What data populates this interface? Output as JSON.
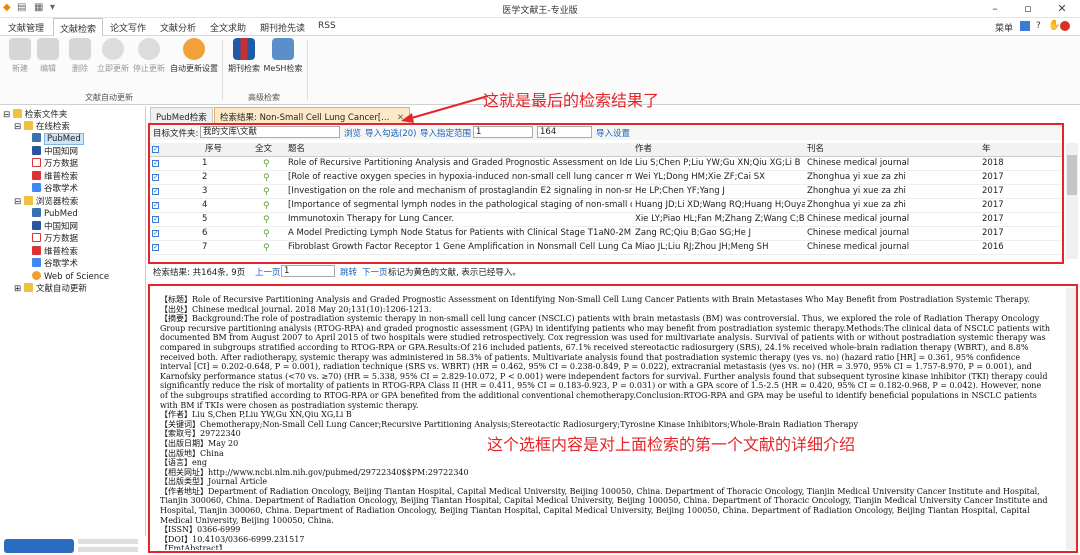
{
  "window": {
    "title": "医学文献王-专业版"
  },
  "menu": {
    "items": [
      "文献管理",
      "文献检索",
      "论文写作",
      "文献分析",
      "全文求助",
      "期刊抢先读",
      "RSS"
    ],
    "active": 1,
    "right": "菜单"
  },
  "ribbon": {
    "buttons": [
      {
        "label": "新建",
        "enabled": false
      },
      {
        "label": "编辑",
        "enabled": false
      },
      {
        "label": "删除",
        "enabled": false
      },
      {
        "label": "立即更新",
        "enabled": false
      },
      {
        "label": "停止更新",
        "enabled": false
      },
      {
        "label": "自动更新设置",
        "enabled": true
      },
      {
        "label": "期刊检索",
        "enabled": true
      },
      {
        "label": "MeSH检索",
        "enabled": true
      }
    ],
    "groups": [
      "文献自动更新",
      "高级检索"
    ]
  },
  "tree": {
    "root": "检索文件夹",
    "online": "在线检索",
    "online_items": [
      "PubMed",
      "中国知网",
      "万方数据",
      "维普检索",
      "谷歌学术"
    ],
    "browser": "浏览器检索",
    "browser_items": [
      "PubMed",
      "中国知网",
      "万方数据",
      "维普检索",
      "谷歌学术",
      "Web of Science"
    ],
    "auto": "文献自动更新"
  },
  "tabs": [
    "PubMed检索",
    "检索结果: Non-Small Cell Lung Cancer[..."
  ],
  "search_bar": {
    "target_label": "目标文件夹:",
    "target_value": "我的文库\\文献",
    "browse": "浏览",
    "import_checked": "导入勾选(20)",
    "import_range": "导入指定范围",
    "range_from": "1",
    "range_sep": "-",
    "range_to": "164",
    "import_settings": "导入设置"
  },
  "table": {
    "columns": [
      "序号",
      "全文",
      "题名",
      "作者",
      "刊名",
      "年"
    ],
    "rows": [
      {
        "no": "1",
        "title": "Role of Recursive Partitioning Analysis and Graded Prognostic Assessment on Iden...",
        "authors": "Liu S;Chen P;Liu YW;Gu XN;Qiu XG;Li B",
        "journal": "Chinese medical journal",
        "year": "2018"
      },
      {
        "no": "2",
        "title": "[Role of reactive oxygen species in hypoxia-induced non-small cell lung cancer mi...",
        "authors": "Wei YL;Dong HM;Xie ZF;Cai SX",
        "journal": "Zhonghua yi xue za zhi",
        "year": "2017"
      },
      {
        "no": "3",
        "title": "[Investigation on the role and mechanism of prostaglandin E2 signaling in non-sm...",
        "authors": "He LP;Chen YF;Yang J",
        "journal": "Zhonghua yi xue za zhi",
        "year": "2017"
      },
      {
        "no": "4",
        "title": "[Importance of segmental lymph nodes in the pathological staging of non-small ce...",
        "authors": "Huang JD;Li XD;Wang RQ;Huang H;Ouya...",
        "journal": "Zhonghua yi xue za zhi",
        "year": "2017"
      },
      {
        "no": "5",
        "title": "Immunotoxin Therapy for Lung Cancer.",
        "authors": "Xie LY;Piao HL;Fan M;Zhang Z;Wang C;Bi...",
        "journal": "Chinese medical journal",
        "year": "2017"
      },
      {
        "no": "6",
        "title": "A Model Predicting Lymph Node Status for Patients with Clinical Stage T1aN0-2M...",
        "authors": "Zang RC;Qiu B;Gao SG;He J",
        "journal": "Chinese medical journal",
        "year": "2017"
      },
      {
        "no": "7",
        "title": "Fibroblast Growth Factor Receptor 1 Gene Amplification in Nonsmall Cell Lung Ca...",
        "authors": "Miao JL;Liu RJ;Zhou JH;Meng SH",
        "journal": "Chinese medical journal",
        "year": "2016"
      }
    ]
  },
  "pager": {
    "summary": "检索结果: 共164条, 9页",
    "prev": "上一页",
    "page": "1",
    "jump": "跳转",
    "next": "下一页",
    "note": "标记为黄色的文献, 表示已经导入。"
  },
  "annotations": {
    "top": "这就是最后的检索结果了",
    "bottom": "这个选框内容是对上面检索的第一个文献的详细介绍"
  },
  "detail": [
    "【标题】Role of Recursive Partitioning Analysis and Graded Prognostic Assessment on Identifying Non-Small Cell Lung Cancer Patients with Brain Metastases Who May Benefit from Postradiation Systemic Therapy.",
    "【出处】Chinese medical journal. 2018 May 20;131(10):1206-1213.",
    "【摘要】Background:The role of postradiation systemic therapy in non-small cell lung cancer (NSCLC) patients with brain metastasis (BM) was controversial. Thus, we explored the role of Radiation Therapy Oncology Group recursive partitioning analysis (RTOG-RPA) and graded prognostic assessment (GPA) in identifying patients who may benefit from postradiation systemic therapy.Methods:The clinical data of NSCLC patients with documented BM from August 2007 to April 2015 of two hospitals were studied retrospectively. Cox regression was used for multivariate analysis. Survival of patients with or without postradiation systemic therapy was compared in subgroups stratified according to RTOG-RPA or GPA.Results:Of 216 included patients, 67.1% received stereotactic radiosurgery (SRS), 24.1% received whole-brain radiation therapy (WBRT), and 8.8% received both. After radiotherapy, systemic therapy was administered in 58.3% of patients. Multivariate analysis found that postradiation systemic therapy (yes vs. no) (hazard ratio [HR] = 0.361, 95% confidence interval [CI] = 0.202-0.648, P = 0.001), radiation technique (SRS vs. WBRT) (HR = 0.462, 95% CI = 0.238-0.849, P = 0.022), extracranial metastasis (yes vs. no) (HR = 3.970, 95% CI = 1.757-8.970, P = 0.001), and Karnofsky performance status (<70 vs. ≥70) (HR = 5.338, 95% CI = 2.829-10.072, P < 0.001) were independent factors for survival. Further analysis found that subsequent tyrosine kinase inhibitor (TKI) therapy could significantly reduce the risk of mortality of patients in RTOG-RPA Class II (HR = 0.411, 95% CI = 0.183-0.923, P = 0.031) or with a GPA score of 1.5-2.5 (HR = 0.420, 95% CI = 0.182-0.968, P = 0.042). However, none of the subgroups stratified according to RTOG-RPA or GPA benefited from the additional conventional chemotherapy.Conclusion:RTOG-RPA and GPA may be useful to identify beneficial populations in NSCLC patients with BM if TKIs were chosen as postradiation systemic therapy.",
    "【作者】Liu S,Chen P,Liu YW,Gu XN,Qiu XG,Li B",
    "【关键词】Chemotherapy;Non-Small Cell Lung Cancer;Recursive Partitioning Analysis;Stereotactic Radiosurgery;Tyrosine Kinase Inhibitors;Whole-Brain Radiation Therapy",
    "【索取号】29722340",
    "【出版日期】May 20",
    "【出版地】China",
    "【语言】eng",
    "【相关网址】http://www.ncbi.nlm.nih.gov/pubmed/29722340$$PM:29722340",
    "【出版类型】Journal Article",
    "【作者地址】Department of Radiation Oncology, Beijing Tiantan Hospital, Capital Medical University, Beijing 100050, China. Department of Thoracic Oncology, Tianjin Medical University Cancer Institute and Hospital, Tianjin 300060, China. Department of Radiation Oncology, Beijing Tiantan Hospital, Capital Medical University, Beijing 100050, China. Department of Thoracic Oncology, Tianjin Medical University Cancer Institute and Hospital, Tianjin 300060, China. Department of Radiation Oncology, Beijing Tiantan Hospital, Capital Medical University, Beijing 100050, China. Department of Radiation Oncology, Beijing Tiantan Hospital, Capital Medical University, Beijing 100050, China.",
    "【ISSN】0366-6999",
    "【DOI】10.4103/0366-6999.231517",
    "【FmtAbstract】"
  ],
  "colors": {
    "accent": "#e4252a",
    "selected": "#cde6f7",
    "tab_active": "#fde8c8",
    "link": "#1a5fb4"
  }
}
